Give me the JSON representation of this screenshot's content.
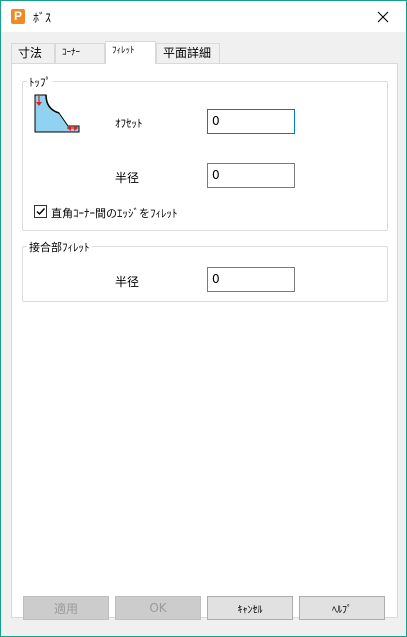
{
  "window": {
    "title": "ﾎﾞｽ",
    "app_icon_letter": "P",
    "accent_color": "#17a089"
  },
  "tabs": [
    {
      "label": "寸法",
      "active": false
    },
    {
      "label": "ｺｰﾅｰ",
      "active": false
    },
    {
      "label": "ﾌｨﾚｯﾄ",
      "active": true
    },
    {
      "label": "平面詳細",
      "active": false
    }
  ],
  "top_group": {
    "title": "ﾄｯﾌﾟ",
    "offset_label": "ｵﾌｾｯﾄ",
    "offset_value": "0",
    "radius_label": "半径",
    "radius_value": "0",
    "checkbox_label": "直角ｺｰﾅｰ間のｴｯｼﾞをﾌｨﾚｯﾄ",
    "checkbox_checked": true
  },
  "joint_group": {
    "title": "接合部ﾌｨﾚｯﾄ",
    "radius_label": "半径",
    "radius_value": "0"
  },
  "buttons": {
    "apply": "適用",
    "ok": "OK",
    "cancel": "ｷｬﾝｾﾙ",
    "help": "ﾍﾙﾌﾟ"
  }
}
